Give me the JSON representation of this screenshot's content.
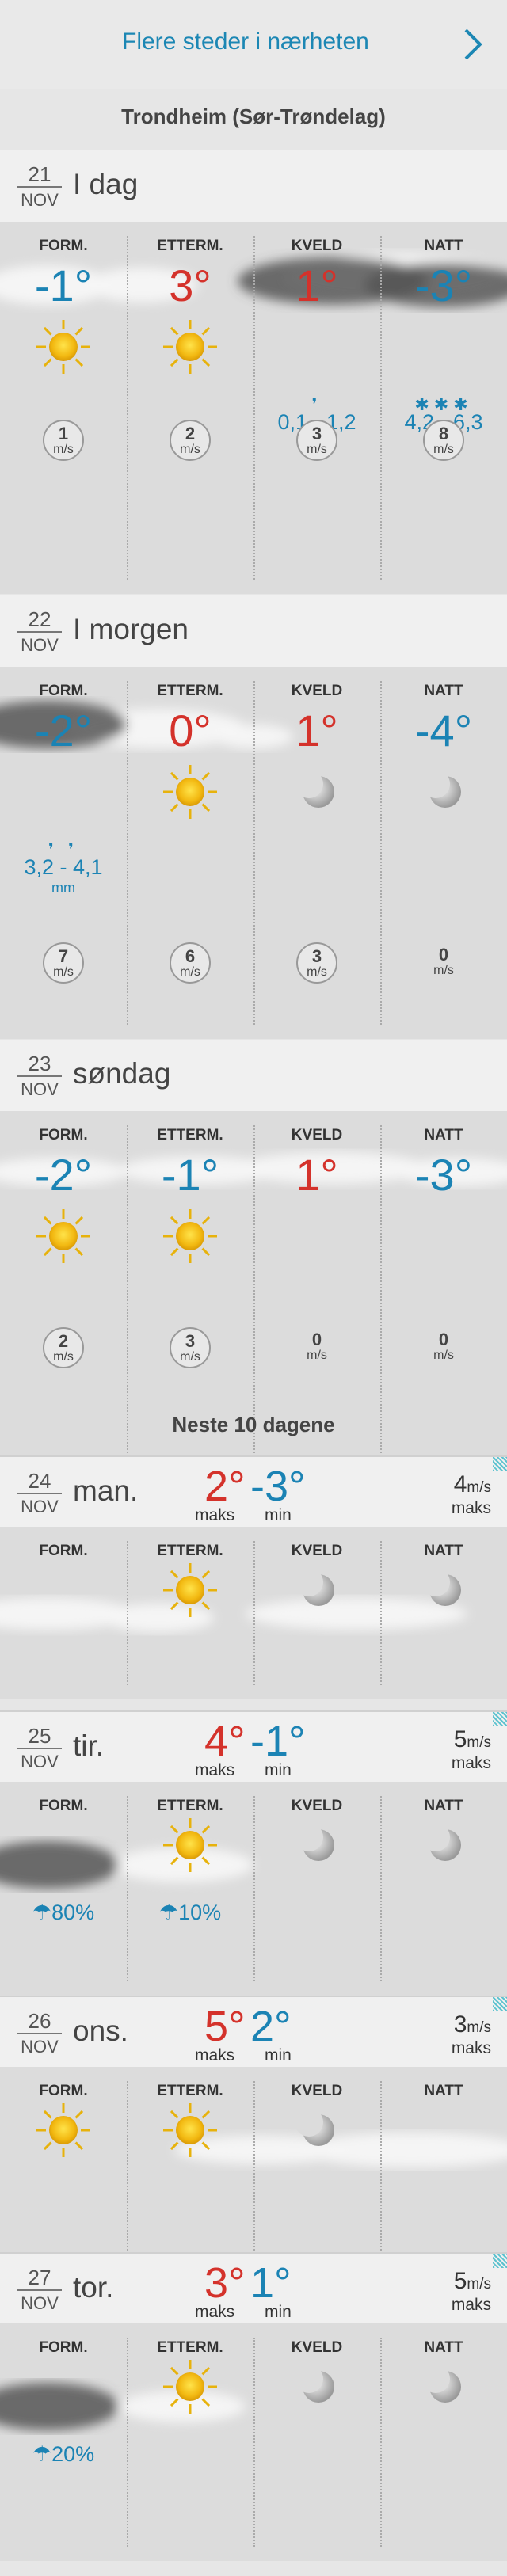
{
  "header": {
    "nearby_label": "Flere steder i nærheten",
    "location": "Trondheim (Sør-Trøndelag)"
  },
  "periods": [
    "FORM.",
    "ETTERM.",
    "KVELD",
    "NATT"
  ],
  "units": {
    "ms": "m/s",
    "mm": "mm",
    "maks": "maks",
    "min": "min"
  },
  "days": [
    {
      "date": "21",
      "month": "NOV",
      "name": "I dag",
      "temps": [
        "-1°",
        "3°",
        "1°",
        "-3°"
      ],
      "precip": [
        "",
        "",
        "0,1 - 1,2",
        "4,2 - 6,3"
      ],
      "wind": [
        "1",
        "2",
        "3",
        "8"
      ]
    },
    {
      "date": "22",
      "month": "NOV",
      "name": "I morgen",
      "temps": [
        "-2°",
        "0°",
        "1°",
        "-4°"
      ],
      "precip": [
        "3,2 - 4,1",
        "",
        "",
        ""
      ],
      "wind": [
        "7",
        "6",
        "3",
        "0"
      ]
    },
    {
      "date": "23",
      "month": "NOV",
      "name": "søndag",
      "temps": [
        "-2°",
        "-1°",
        "1°",
        "-3°"
      ],
      "precip": [
        "",
        "",
        "",
        ""
      ],
      "wind": [
        "2",
        "3",
        "0",
        "0"
      ]
    }
  ],
  "next10": {
    "title": "Neste 10 dagene"
  },
  "long_days": [
    {
      "date": "24",
      "month": "NOV",
      "name": "man.",
      "max": "2°",
      "min": "-3°",
      "wind": "4",
      "probs": [
        "",
        "",
        "",
        ""
      ]
    },
    {
      "date": "25",
      "month": "NOV",
      "name": "tir.",
      "max": "4°",
      "min": "-1°",
      "wind": "5",
      "probs": [
        "80%",
        "10%",
        "",
        ""
      ]
    },
    {
      "date": "26",
      "month": "NOV",
      "name": "ons.",
      "max": "5°",
      "min": "2°",
      "wind": "3",
      "probs": [
        "",
        "",
        "",
        ""
      ]
    },
    {
      "date": "27",
      "month": "NOV",
      "name": "tor.",
      "max": "3°",
      "min": "1°",
      "wind": "5",
      "probs": [
        "20%",
        "",
        "",
        ""
      ]
    }
  ],
  "colors": {
    "accent": "#1c87b4",
    "warm": "#d4322b",
    "cold": "#1b83b4"
  }
}
